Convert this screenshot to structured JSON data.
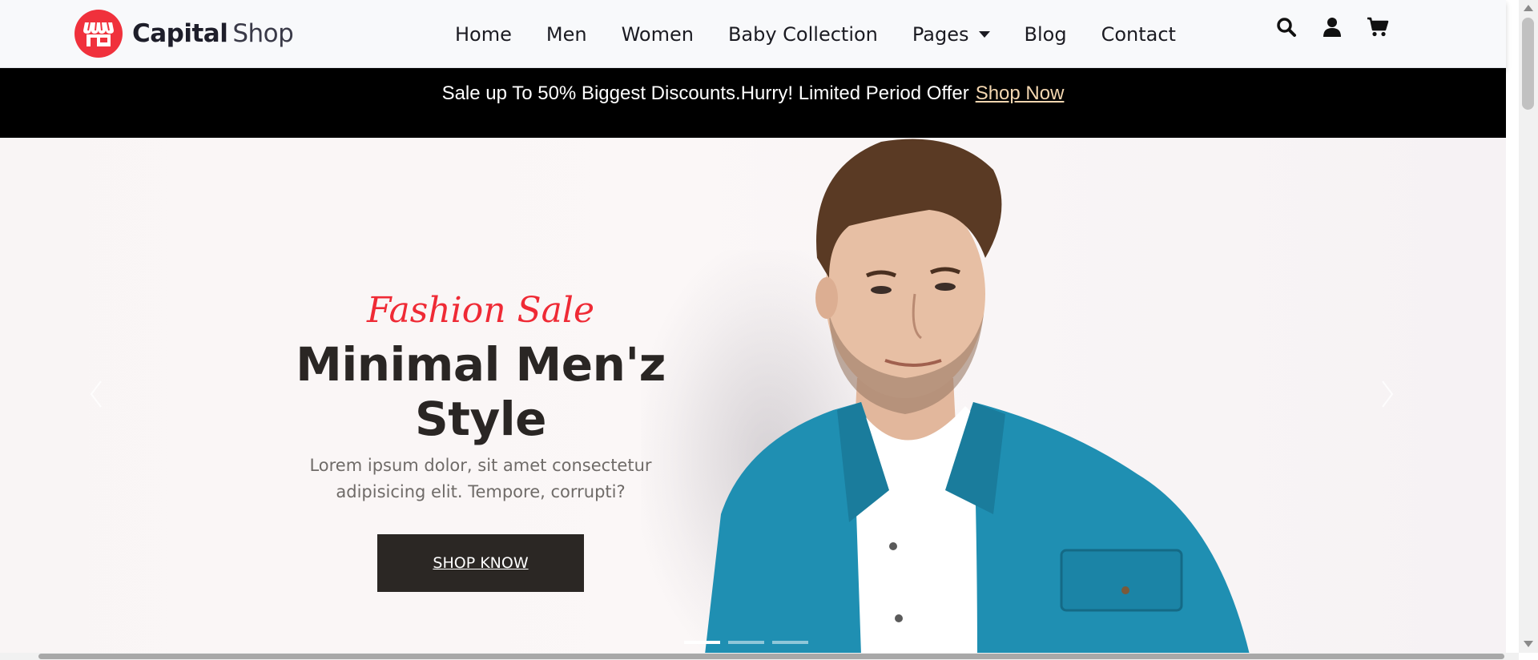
{
  "brand": {
    "name_bold": "Capital",
    "name_light": "Shop",
    "accent": "#f0313c"
  },
  "nav": {
    "items": [
      {
        "label": "Home"
      },
      {
        "label": "Men"
      },
      {
        "label": "Women"
      },
      {
        "label": "Baby Collection"
      },
      {
        "label": "Pages",
        "has_dropdown": true
      },
      {
        "label": "Blog"
      },
      {
        "label": "Contact"
      }
    ]
  },
  "header_icons": [
    "search-icon",
    "user-icon",
    "cart-icon"
  ],
  "promo": {
    "text": "Sale up To 50% Biggest Discounts.Hurry! Limited Period Offer",
    "link": "Shop Now",
    "link_color": "#f3d6b0"
  },
  "hero": {
    "kicker": "Fashion Sale",
    "title": "Minimal Men'z Style",
    "description": "Lorem ipsum dolor, sit amet consectetur adipisicing elit. Tempore, corrupti?",
    "cta": "SHOP KNOW",
    "slides": 3,
    "active_slide": 1
  }
}
